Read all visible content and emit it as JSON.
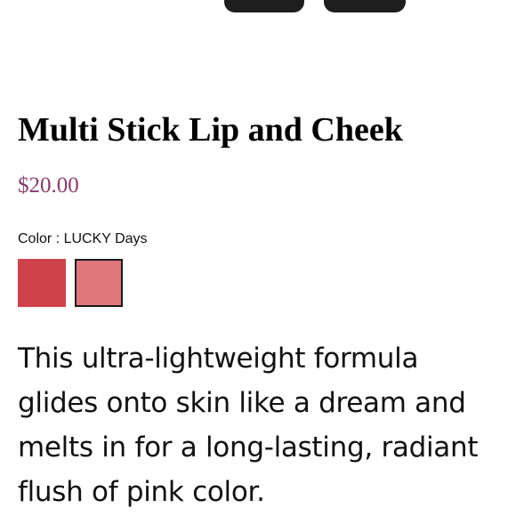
{
  "product": {
    "title": "Multi Stick Lip and Cheek",
    "price": "$20.00",
    "color_label": "Color : LUCKY Days",
    "swatches": [
      {
        "color": "#cf4249",
        "selected": false
      },
      {
        "color": "#e0777a",
        "selected": true
      }
    ],
    "description": "This ultra-lightweight formula glides onto skin like a dream and melts in for a long-lasting, radiant flush of pink color."
  },
  "colors": {
    "price": "#8a3c6a",
    "text": "#111111",
    "stick_cap": "#1e1e1e"
  }
}
